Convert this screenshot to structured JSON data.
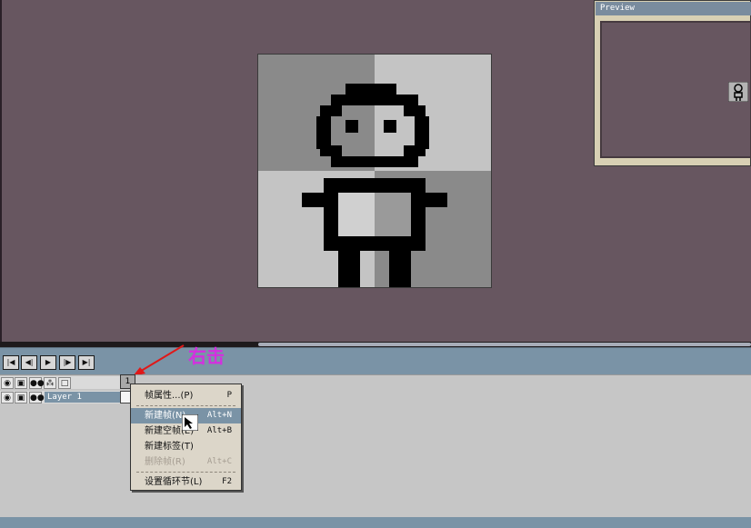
{
  "preview": {
    "title": "Preview"
  },
  "timeline": {
    "buttons": [
      {
        "name": "first-frame-button",
        "glyph": "|◀"
      },
      {
        "name": "prev-frame-button",
        "glyph": "◀|"
      },
      {
        "name": "play-button",
        "glyph": "▶"
      },
      {
        "name": "next-frame-button",
        "glyph": "|▶"
      },
      {
        "name": "last-frame-button",
        "glyph": "▶|"
      }
    ],
    "frame_number": "1"
  },
  "annotation": {
    "text": "右击",
    "color": "#d42fe0"
  },
  "layers": {
    "header_icons": [
      "eye-icon",
      "lock-icon",
      "onion-skin-icon",
      "link-icon",
      "frame-icon"
    ],
    "rows": [
      {
        "name": "Layer 1"
      }
    ]
  },
  "context_menu": {
    "items": [
      {
        "label": "帧属性...(P)",
        "shortcut": "P",
        "state": "normal"
      },
      {
        "separator": true
      },
      {
        "label": "新建帧(N)",
        "shortcut": "Alt+N",
        "state": "highlighted"
      },
      {
        "label": "新建空帧(E)",
        "shortcut": "Alt+B",
        "state": "normal"
      },
      {
        "label": "新建标签(T)",
        "shortcut": "",
        "state": "normal"
      },
      {
        "label": "删除帧(R)",
        "shortcut": "Alt+C",
        "state": "disabled"
      },
      {
        "separator": true
      },
      {
        "label": "设置循环节(L)",
        "shortcut": "F2",
        "state": "normal"
      }
    ]
  },
  "colors": {
    "canvas_bg": "#675660",
    "accent": "#7a93a6",
    "annotation": "#d42fe0"
  }
}
